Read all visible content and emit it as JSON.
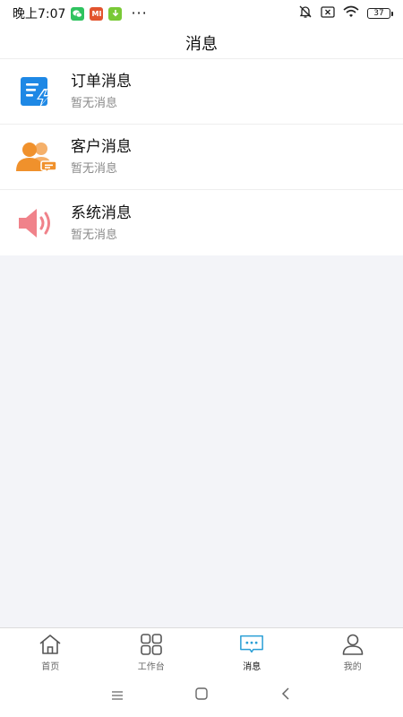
{
  "status_bar": {
    "time": "晚上7:07",
    "app_icons": [
      "wechat-icon",
      "mi-icon",
      "download-icon"
    ],
    "mi_label": "MI",
    "more": "···",
    "battery": "37"
  },
  "header": {
    "title": "消息"
  },
  "messages": [
    {
      "title": "订单消息",
      "subtitle": "暂无消息",
      "icon": "order-icon",
      "color": "#1e88e5"
    },
    {
      "title": "客户消息",
      "subtitle": "暂无消息",
      "icon": "customers-icon",
      "color": "#f0912c"
    },
    {
      "title": "系统消息",
      "subtitle": "暂无消息",
      "icon": "speaker-icon",
      "color": "#f0828a"
    }
  ],
  "tabs": [
    {
      "label": "首页",
      "icon": "home-icon",
      "active": false
    },
    {
      "label": "工作台",
      "icon": "grid-icon",
      "active": false
    },
    {
      "label": "消息",
      "icon": "chat-icon",
      "active": true
    },
    {
      "label": "我的",
      "icon": "person-icon",
      "active": false
    }
  ],
  "system_nav": [
    "menu-icon",
    "home-square-icon",
    "back-icon"
  ],
  "colors": {
    "accent": "#2a9fd6",
    "background": "#f3f4f8"
  }
}
